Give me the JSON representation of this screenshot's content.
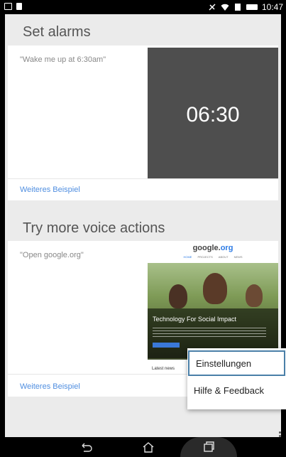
{
  "status_bar": {
    "time": "10:47"
  },
  "cards": [
    {
      "title": "Set alarms",
      "example": "\"Wake me up at 6:30am\"",
      "preview_time": "06:30",
      "link": "Weiteres Beispiel"
    },
    {
      "title": "Try more voice actions",
      "example": "\"Open google.org\"",
      "preview": {
        "logo_main": "google.",
        "logo_org": "org",
        "nav": [
          "HOME",
          "PROJECTS",
          "ABOUT",
          "NEWS"
        ],
        "headline": "Technology For Social Impact",
        "news_label": "Latest news"
      },
      "link": "Weiteres Beispiel"
    }
  ],
  "menu": {
    "items": [
      "Einstellungen",
      "Hilfe & Feedback"
    ]
  }
}
